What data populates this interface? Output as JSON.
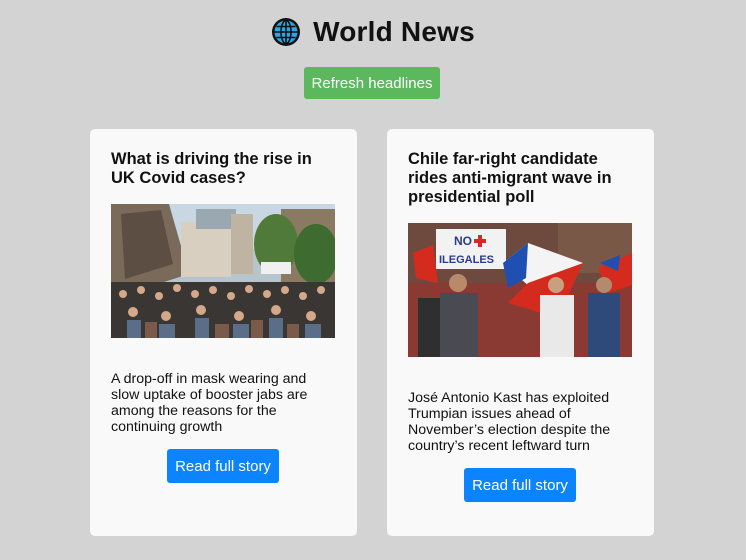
{
  "header": {
    "icon": "globe-icon",
    "title": "World News"
  },
  "toolbar": {
    "refresh_label": "Refresh headlines"
  },
  "colors": {
    "background": "#d3d3d3",
    "refresh_button": "#5cb85c",
    "read_button": "#0d84ff",
    "card": "#f9f9f9"
  },
  "articles": [
    {
      "headline": "What is driving the rise in UK Covid cases?",
      "image": "crowded-street-photo",
      "summary": "A drop-off in mask wearing and slow uptake of booster jabs are among the reasons for the continuing growth",
      "button_label": "Read full story"
    },
    {
      "headline": "Chile far-right candidate rides anti-migrant wave in presidential poll",
      "image": "protest-photo",
      "sign_text": [
        "NO",
        "ILEGALES"
      ],
      "summary": "José Antonio Kast has exploited Trumpian issues ahead of November’s election despite the country’s recent leftward turn",
      "button_label": "Read full story"
    }
  ]
}
